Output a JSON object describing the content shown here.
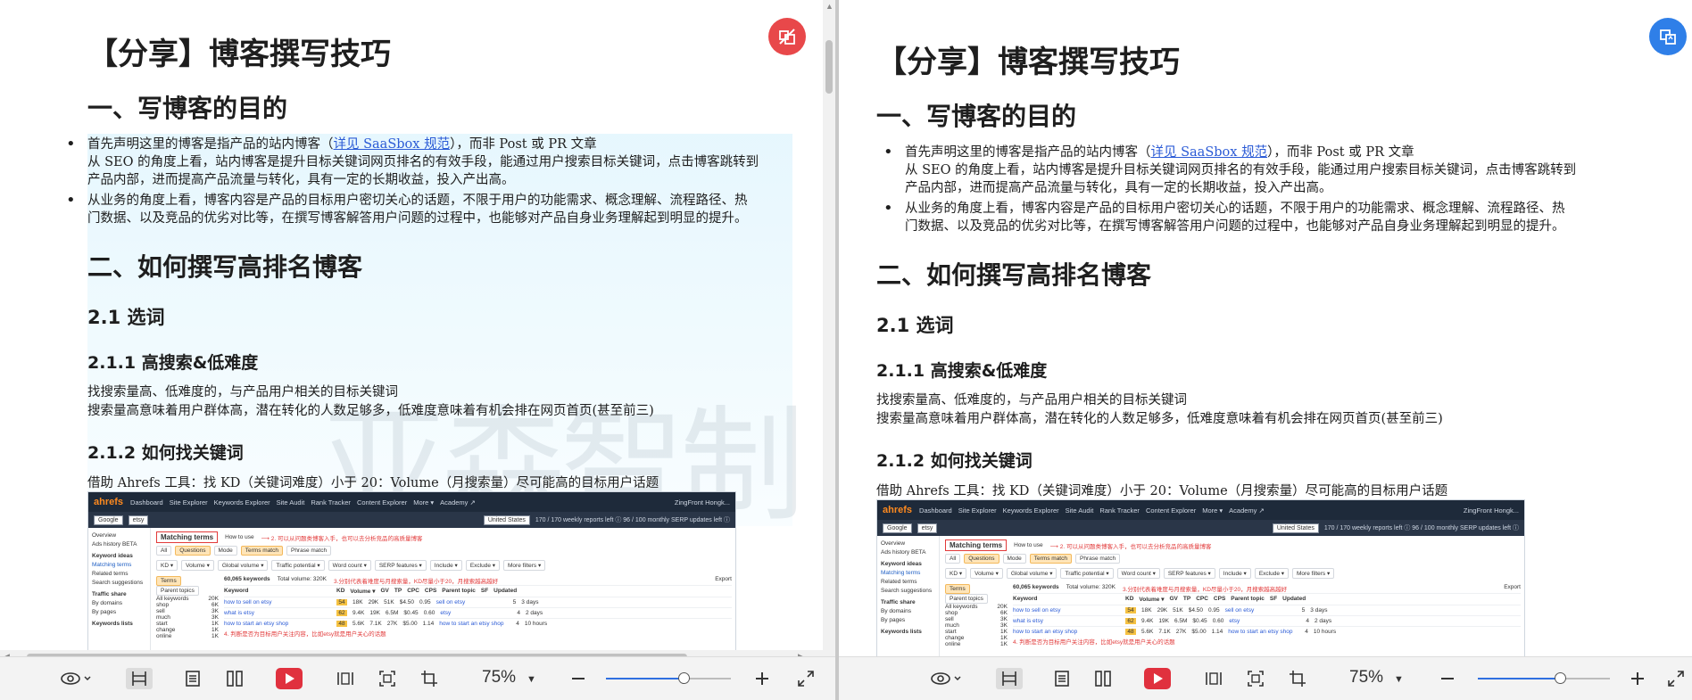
{
  "document": {
    "title": "【分享】博客撰写技巧",
    "section1": {
      "heading": "一、写博客的目的",
      "bullet1": {
        "pre": "首先声明这里的博客是指产品的站内博客（",
        "link": "详见 SaaSbox 规范",
        "post": "），而非 Post 或 PR 文章",
        "line2": "从 SEO 的角度上看，站内博客是提升目标关键词网页排名的有效手段，能通过用户搜索目标关键词，点击博客跳转到",
        "line3": "产品内部，进而提高产品流量与转化，具有一定的长期收益，投入产出高。"
      },
      "bullet2": {
        "line1": "从业务的角度上看，博客内容是产品的目标用户密切关心的话题，不限于用户的功能需求、概念理解、流程路径、热",
        "line2": "门数据、以及竞品的优劣对比等，在撰写博客解答用户问题的过程中，也能够对产品自身业务理解起到明显的提升。"
      }
    },
    "section2": {
      "heading": "二、如何撰写高排名博客",
      "sub21": "2.1  选词",
      "sub211": "2.1.1  高搜索&低难度",
      "p1": "找搜索量高、低难度的，与产品用户相关的目标关键词",
      "p2": "搜索量高意味着用户群体高，潜在转化的人数足够多，低难度意味着有机会排在网页首页(甚至前三)",
      "sub212": "2.1.2  如何找关键词",
      "p3": "借助 Ahrefs 工具：找 KD（关键词难度）小于 20：Volume（月搜索量）尽可能高的目标用户话题"
    },
    "watermark": "亚森智制",
    "screenshot": {
      "logo": "ahrefs",
      "nav": [
        "Dashboard",
        "Site Explorer",
        "Keywords Explorer",
        "Site Audit",
        "Rank Tracker",
        "Content Explorer",
        "More ▾",
        "Academy ↗"
      ],
      "account": "ZingFront Hongk...",
      "engine": "Google",
      "query": "etsy",
      "country": "United States",
      "quota": "170 / 170 weekly reports left  ⓘ    96 / 100 monthly SERP updates left  ⓘ",
      "sidebar": [
        "Overview",
        "Ads history BETA",
        "Keyword ideas",
        "Matching terms",
        "Related terms",
        "Search suggestions",
        "Traffic share",
        "By domains",
        "By pages",
        "Keywords lists"
      ],
      "panel_title": "Matching terms",
      "how_to": "How to use",
      "tabs": [
        "All",
        "Questions",
        "Mode",
        "Terms match",
        "Phrase match"
      ],
      "filters": [
        "KD ▾",
        "Volume ▾",
        "Global volume ▾",
        "Traffic potential ▾",
        "Word count ▾",
        "SERP features ▾",
        "Include ▾",
        "Exclude ▾",
        "More filters ▾"
      ],
      "annot1": "2. 可以从问题类博客入手，也可以去分析竞品的高质量博客",
      "annot2": "3.分别代表着难度与月搜索量，KD尽量小于20，月搜索越高越好",
      "annot3": "4. 判断是否为目标用户关注内容，比如etsy就是用户关心的话题",
      "count": "60,065 keywords",
      "total": "Total volume: 320K",
      "export": "Export",
      "terms_tabs": [
        "Terms",
        "Parent topics"
      ],
      "terms": [
        {
          "label": "All keywords",
          "n": "20K"
        },
        {
          "label": "shop",
          "n": "6K"
        },
        {
          "label": "sell",
          "n": "3K"
        },
        {
          "label": "much",
          "n": "3K"
        },
        {
          "label": "start",
          "n": "1K"
        },
        {
          "label": "change",
          "n": "1K"
        },
        {
          "label": "online",
          "n": "1K"
        }
      ],
      "columns": [
        "Keyword",
        "KD",
        "Volume ▾",
        "GV",
        "TP",
        "CPC",
        "CPS",
        "Parent topic",
        "SF",
        "Updated"
      ],
      "rows": [
        {
          "kw": "how to sell on etsy",
          "kd": "54",
          "vol": "18K",
          "gv": "29K",
          "tp": "51K",
          "cpc": "$4.50",
          "cps": "0.95",
          "parent": "sell on etsy",
          "sf": "5",
          "upd": "3 days"
        },
        {
          "kw": "what is etsy",
          "kd": "62",
          "vol": "9.4K",
          "gv": "19K",
          "tp": "6.5M",
          "cpc": "$0.45",
          "cps": "0.60",
          "parent": "etsy",
          "sf": "4",
          "upd": "2 days"
        },
        {
          "kw": "how to start an etsy shop",
          "kd": "48",
          "vol": "5.6K",
          "gv": "7.1K",
          "tp": "27K",
          "cpc": "$5.00",
          "cps": "1.14",
          "parent": "how to start an etsy shop",
          "sf": "4",
          "upd": "10 hours"
        }
      ]
    }
  },
  "toolbar": {
    "zoom_left": "75%",
    "zoom_right": "75%",
    "zoom_level": 0.62
  },
  "colors": {
    "fab_left": "#e8484a",
    "fab_right": "#2f7fe8",
    "record": "#e0313e",
    "accent": "#2f6fe0"
  }
}
